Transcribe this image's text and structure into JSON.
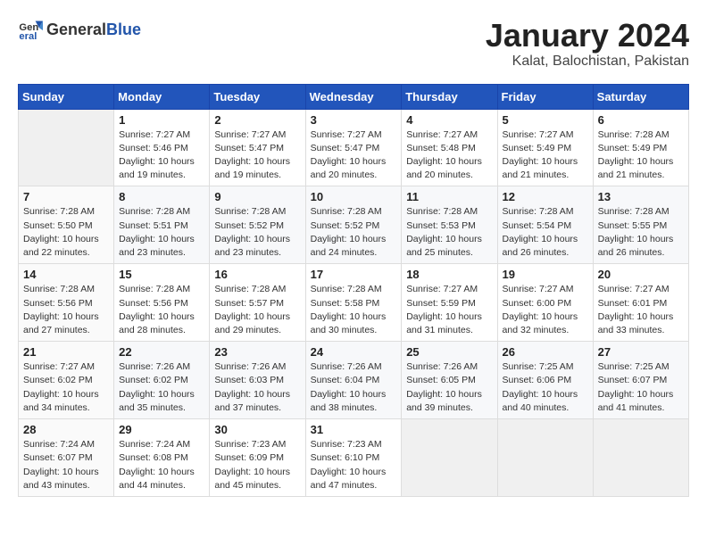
{
  "header": {
    "logo_general": "General",
    "logo_blue": "Blue",
    "month_year": "January 2024",
    "location": "Kalat, Balochistan, Pakistan"
  },
  "columns": [
    "Sunday",
    "Monday",
    "Tuesday",
    "Wednesday",
    "Thursday",
    "Friday",
    "Saturday"
  ],
  "weeks": [
    [
      {
        "day": "",
        "info": ""
      },
      {
        "day": "1",
        "info": "Sunrise: 7:27 AM\nSunset: 5:46 PM\nDaylight: 10 hours\nand 19 minutes."
      },
      {
        "day": "2",
        "info": "Sunrise: 7:27 AM\nSunset: 5:47 PM\nDaylight: 10 hours\nand 19 minutes."
      },
      {
        "day": "3",
        "info": "Sunrise: 7:27 AM\nSunset: 5:47 PM\nDaylight: 10 hours\nand 20 minutes."
      },
      {
        "day": "4",
        "info": "Sunrise: 7:27 AM\nSunset: 5:48 PM\nDaylight: 10 hours\nand 20 minutes."
      },
      {
        "day": "5",
        "info": "Sunrise: 7:27 AM\nSunset: 5:49 PM\nDaylight: 10 hours\nand 21 minutes."
      },
      {
        "day": "6",
        "info": "Sunrise: 7:28 AM\nSunset: 5:49 PM\nDaylight: 10 hours\nand 21 minutes."
      }
    ],
    [
      {
        "day": "7",
        "info": "Sunrise: 7:28 AM\nSunset: 5:50 PM\nDaylight: 10 hours\nand 22 minutes."
      },
      {
        "day": "8",
        "info": "Sunrise: 7:28 AM\nSunset: 5:51 PM\nDaylight: 10 hours\nand 23 minutes."
      },
      {
        "day": "9",
        "info": "Sunrise: 7:28 AM\nSunset: 5:52 PM\nDaylight: 10 hours\nand 23 minutes."
      },
      {
        "day": "10",
        "info": "Sunrise: 7:28 AM\nSunset: 5:52 PM\nDaylight: 10 hours\nand 24 minutes."
      },
      {
        "day": "11",
        "info": "Sunrise: 7:28 AM\nSunset: 5:53 PM\nDaylight: 10 hours\nand 25 minutes."
      },
      {
        "day": "12",
        "info": "Sunrise: 7:28 AM\nSunset: 5:54 PM\nDaylight: 10 hours\nand 26 minutes."
      },
      {
        "day": "13",
        "info": "Sunrise: 7:28 AM\nSunset: 5:55 PM\nDaylight: 10 hours\nand 26 minutes."
      }
    ],
    [
      {
        "day": "14",
        "info": "Sunrise: 7:28 AM\nSunset: 5:56 PM\nDaylight: 10 hours\nand 27 minutes."
      },
      {
        "day": "15",
        "info": "Sunrise: 7:28 AM\nSunset: 5:56 PM\nDaylight: 10 hours\nand 28 minutes."
      },
      {
        "day": "16",
        "info": "Sunrise: 7:28 AM\nSunset: 5:57 PM\nDaylight: 10 hours\nand 29 minutes."
      },
      {
        "day": "17",
        "info": "Sunrise: 7:28 AM\nSunset: 5:58 PM\nDaylight: 10 hours\nand 30 minutes."
      },
      {
        "day": "18",
        "info": "Sunrise: 7:27 AM\nSunset: 5:59 PM\nDaylight: 10 hours\nand 31 minutes."
      },
      {
        "day": "19",
        "info": "Sunrise: 7:27 AM\nSunset: 6:00 PM\nDaylight: 10 hours\nand 32 minutes."
      },
      {
        "day": "20",
        "info": "Sunrise: 7:27 AM\nSunset: 6:01 PM\nDaylight: 10 hours\nand 33 minutes."
      }
    ],
    [
      {
        "day": "21",
        "info": "Sunrise: 7:27 AM\nSunset: 6:02 PM\nDaylight: 10 hours\nand 34 minutes."
      },
      {
        "day": "22",
        "info": "Sunrise: 7:26 AM\nSunset: 6:02 PM\nDaylight: 10 hours\nand 35 minutes."
      },
      {
        "day": "23",
        "info": "Sunrise: 7:26 AM\nSunset: 6:03 PM\nDaylight: 10 hours\nand 37 minutes."
      },
      {
        "day": "24",
        "info": "Sunrise: 7:26 AM\nSunset: 6:04 PM\nDaylight: 10 hours\nand 38 minutes."
      },
      {
        "day": "25",
        "info": "Sunrise: 7:26 AM\nSunset: 6:05 PM\nDaylight: 10 hours\nand 39 minutes."
      },
      {
        "day": "26",
        "info": "Sunrise: 7:25 AM\nSunset: 6:06 PM\nDaylight: 10 hours\nand 40 minutes."
      },
      {
        "day": "27",
        "info": "Sunrise: 7:25 AM\nSunset: 6:07 PM\nDaylight: 10 hours\nand 41 minutes."
      }
    ],
    [
      {
        "day": "28",
        "info": "Sunrise: 7:24 AM\nSunset: 6:07 PM\nDaylight: 10 hours\nand 43 minutes."
      },
      {
        "day": "29",
        "info": "Sunrise: 7:24 AM\nSunset: 6:08 PM\nDaylight: 10 hours\nand 44 minutes."
      },
      {
        "day": "30",
        "info": "Sunrise: 7:23 AM\nSunset: 6:09 PM\nDaylight: 10 hours\nand 45 minutes."
      },
      {
        "day": "31",
        "info": "Sunrise: 7:23 AM\nSunset: 6:10 PM\nDaylight: 10 hours\nand 47 minutes."
      },
      {
        "day": "",
        "info": ""
      },
      {
        "day": "",
        "info": ""
      },
      {
        "day": "",
        "info": ""
      }
    ]
  ]
}
